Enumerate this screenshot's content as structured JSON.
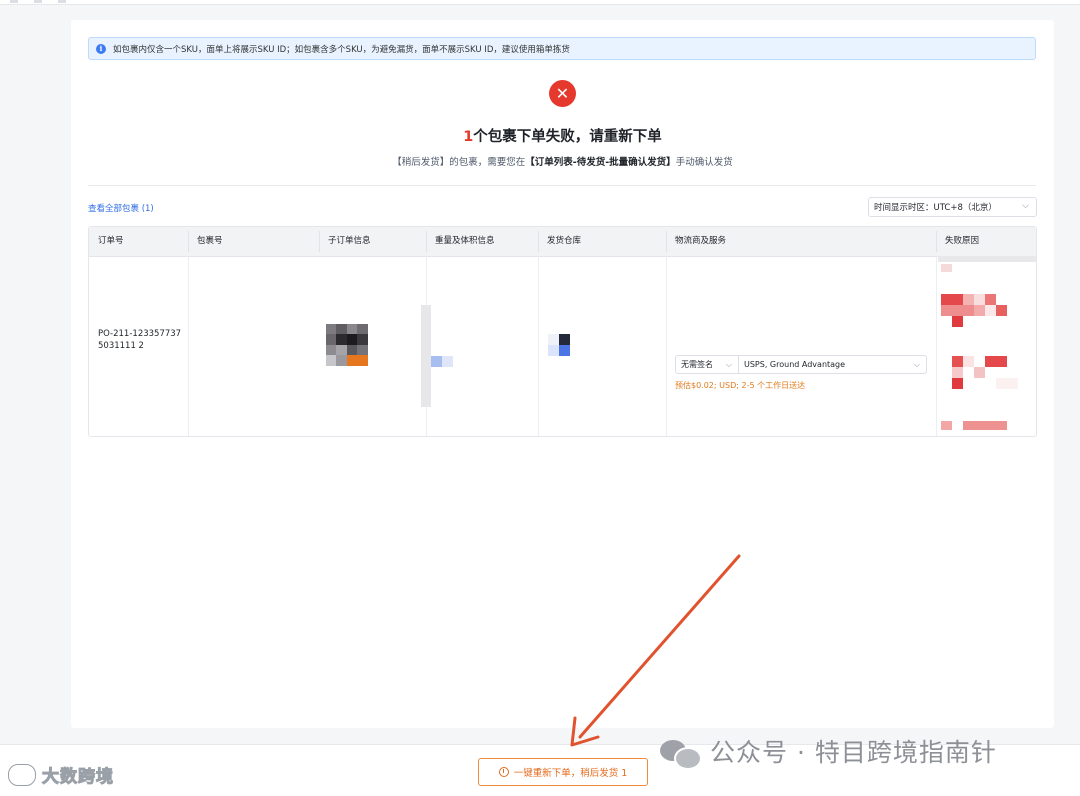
{
  "notice": {
    "text": "如包裹内仅含一个SKU，面单上将展示SKU ID；如包裹含多个SKU，为避免漏货，面单不展示SKU ID，建议使用箱单拣货"
  },
  "result": {
    "count": "1",
    "title": "个包裹下单失败，请重新下单",
    "sub_prefix": "【稍后发货】的包裹，需要您在",
    "sub_bold": "【订单列表-待发货-批量确认发货】",
    "sub_suffix": "手动确认发货"
  },
  "toolbar": {
    "view_all": "查看全部包裹 (1)",
    "timezone": "时间显示时区：UTC+8（北京）"
  },
  "table": {
    "headers": [
      "订单号",
      "包裹号",
      "子订单信息",
      "重量及体积信息",
      "发货仓库",
      "物流商及服务",
      "失败原因"
    ],
    "rows": [
      {
        "order_id": "PO-211-1233577375031111 2",
        "signature": "无需签名",
        "service": "USPS, Ground Advantage",
        "estimate": "预估$0.02; USD; 2-5 个工作日送达"
      }
    ]
  },
  "footer": {
    "retry_button": "一键重新下单，稍后发货 1"
  },
  "watermarks": {
    "left": "大数跨境",
    "right": "公众号 · 特目跨境指南针"
  },
  "colors": {
    "error": "#e5392e",
    "link": "#2f6ce5",
    "warning": "#e27a1b",
    "annotation_arrow": "#e0532e"
  },
  "icons": [
    "info-icon",
    "error-circle-icon",
    "chevron-down-icon",
    "clock-icon",
    "wechat-icon"
  ]
}
